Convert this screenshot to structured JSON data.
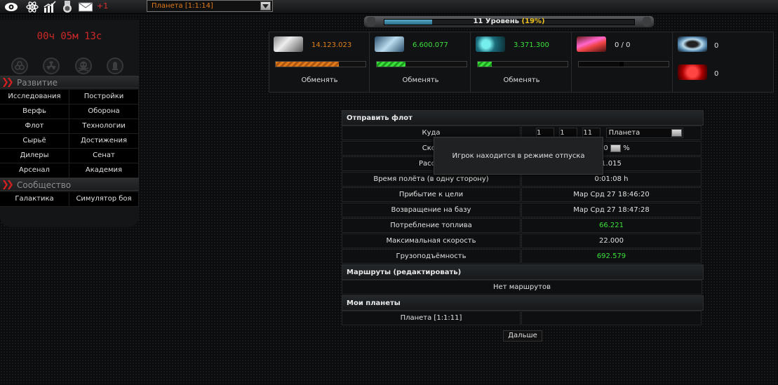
{
  "topbar": {
    "icons": [
      "eye-icon",
      "atom-icon",
      "chart-icon",
      "medal-icon",
      "mail-icon"
    ],
    "mail_count": "+1",
    "planet_select": "Планета [1:1:14]"
  },
  "level": {
    "label": "11 Уровень",
    "percent_text": "(19%)",
    "progress": 0.19
  },
  "timer": "00ч 05м 13с",
  "sidebar": {
    "icons": [
      "biohazard-icon",
      "radiation-icon",
      "skull-icon",
      "bomb-icon"
    ],
    "section1": "Развитие",
    "menu1": [
      "Исследования",
      "Постройки",
      "Верфь",
      "Оборона",
      "Флот",
      "Технологии",
      "Сырьё",
      "Достижения",
      "Дилеры",
      "Сенат",
      "Арсенал",
      "Академия"
    ],
    "section2": "Сообщество",
    "menu2": [
      "Галактика",
      "Симулятор боя"
    ]
  },
  "resources": {
    "items": [
      {
        "value": "14.123.023",
        "color": "#e0801a",
        "fill": 0.7,
        "icon": "metal-icon"
      },
      {
        "value": "6.600.077",
        "color": "#3ce03c",
        "fill": 0.32,
        "icon": "crystal-icon"
      },
      {
        "value": "3.371.300",
        "color": "#3ce03c",
        "fill": 0.16,
        "icon": "deuterium-icon"
      },
      {
        "value": "0 / 0",
        "color": "#e0e0e0",
        "fill": 0.5,
        "icon": "energy-icon"
      }
    ],
    "exchange_label": "Обменять",
    "special1": "0",
    "special2": "0"
  },
  "fleet": {
    "header": "Отправить флот",
    "target_label": "Куда",
    "coords": [
      "1",
      "1",
      "11"
    ],
    "target_type": "Планета",
    "speed_label": "Скор",
    "speed_value": "10",
    "speed_unit": "%",
    "distance_label": "Рассто",
    "distance_value": "1.015",
    "rows": [
      {
        "label": "Время полёта (в одну сторону)",
        "value": "0:01:08 h",
        "green": false
      },
      {
        "label": "Прибытие к цели",
        "value": "Мар Срд 27 18:46:20",
        "green": false
      },
      {
        "label": "Возвращение на базу",
        "value": "Мар Срд 27 18:47:28",
        "green": false
      },
      {
        "label": "Потребление топлива",
        "value": "66.221",
        "green": true
      },
      {
        "label": "Максимальная скорость",
        "value": "22.000",
        "green": false
      },
      {
        "label": "Грузоподъёмность",
        "value": "692.579",
        "green": true
      }
    ],
    "routes_header": "Маршруты (редактировать)",
    "no_routes": "Нет маршрутов",
    "my_planets_header": "Мои планеты",
    "my_planet": "Планета [1:1:11]",
    "next_button": "Дальше"
  },
  "popup": {
    "text": "Игрок находится в режиме отпуска"
  }
}
